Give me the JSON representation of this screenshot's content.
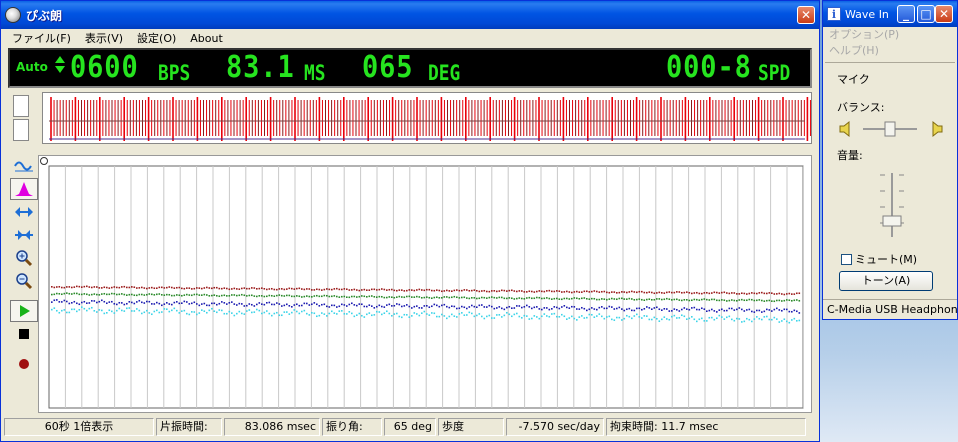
{
  "main_window": {
    "title": "ぴぶ朗",
    "menu": [
      "ファイル(F)",
      "表示(V)",
      "設定(O)",
      "About"
    ],
    "led": {
      "mode": "Auto",
      "bph_value": "0600",
      "bph_unit": "BPS",
      "amplitude_ms_value": "83.1",
      "amplitude_ms_unit": "MS",
      "angle_value": "065",
      "angle_unit": "DEG",
      "rate_value": "000-8",
      "rate_unit": "SPD"
    },
    "status_bar": [
      "60秒 1倍表示",
      "片振時間:",
      "83.086 msec",
      "振り角:",
      "65 deg",
      "歩度",
      "-7.570 sec/day",
      "拘束時間: 11.7 msec"
    ],
    "toolbar_icons": [
      "wave-icon",
      "histogram-icon",
      "expand-h-icon",
      "shrink-h-icon",
      "zoom-in-icon",
      "zoom-out-icon",
      "play-icon",
      "stop-icon",
      "record-icon"
    ],
    "colors": {
      "led_green": "#26e41f",
      "wave_red": "#e8000a",
      "wave_maroon": "#8a1a1a",
      "trace_red": "#9b1c1c",
      "trace_green": "#2a8a2a",
      "trace_blue": "#1b1bb0",
      "trace_cyan": "#3cd4e8"
    }
  },
  "wave_in_window": {
    "title": "Wave In",
    "menu": [
      "オプション(P)",
      "ヘルプ(H)"
    ],
    "section_label": "マイク",
    "balance_label": "バランス:",
    "volume_label": "音量:",
    "mute_label": "ミュート(M)",
    "tone_button": "トーン(A)",
    "device_name": "C-Media USB Headphone",
    "balance_level": 0.5,
    "volume_level": 0.25
  }
}
